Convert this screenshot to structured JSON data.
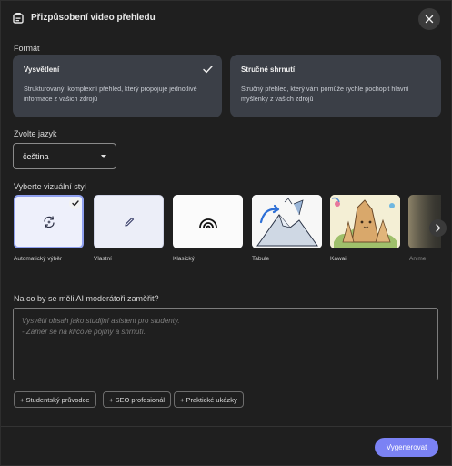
{
  "dialog": {
    "title": "Přizpůsobení video přehledu",
    "close_icon": "close-icon",
    "header_icon": "document-icon"
  },
  "format": {
    "label": "Formát",
    "options": [
      {
        "title": "Vysvětlení",
        "description_line1": "Strukturovaný, komplexní přehled, který propojuje jednotlivé",
        "description_line2": "informace z vašich zdrojů",
        "selected": true
      },
      {
        "title": "Stručné shrnutí",
        "description_line1": "Stručný přehled, který vám pomůže rychle pochopit hlavní",
        "description_line2": "myšlenky z vašich zdrojů",
        "selected": false
      }
    ]
  },
  "language": {
    "label": "Zvolte jazyk",
    "value": "čeština"
  },
  "visual_style": {
    "label": "Vyberte vizuální styl",
    "styles": [
      {
        "name": "Automatický výběr",
        "icon": "auto-refresh-icon",
        "selected": true
      },
      {
        "name": "Vlastní",
        "icon": "pencil-icon",
        "selected": false
      },
      {
        "name": "Klasický",
        "icon": "rainbow-arcs-icon",
        "selected": false
      },
      {
        "name": "Tabule",
        "icon": "whiteboard-illustration",
        "selected": false
      },
      {
        "name": "Kawaii",
        "icon": "kawaii-illustration",
        "selected": false
      },
      {
        "name": "Anime",
        "icon": "anime-illustration",
        "selected": false
      }
    ]
  },
  "focus": {
    "label": "Na co by se měli AI moderátoři zaměřit?",
    "placeholder_line1": "Vysvětli obsah jako studijní asistent pro studenty.",
    "placeholder_line2": "- Zaměř se na klíčové pojmy a shrnutí."
  },
  "chips": [
    "+ Studentský průvodce",
    "+ SEO profesionál",
    "+ Praktické ukázky"
  ],
  "generate_label": "Vygenerovat",
  "colors": {
    "accent": "#7b82f4",
    "background": "#1f1f1f",
    "card": "#3b3f47"
  }
}
